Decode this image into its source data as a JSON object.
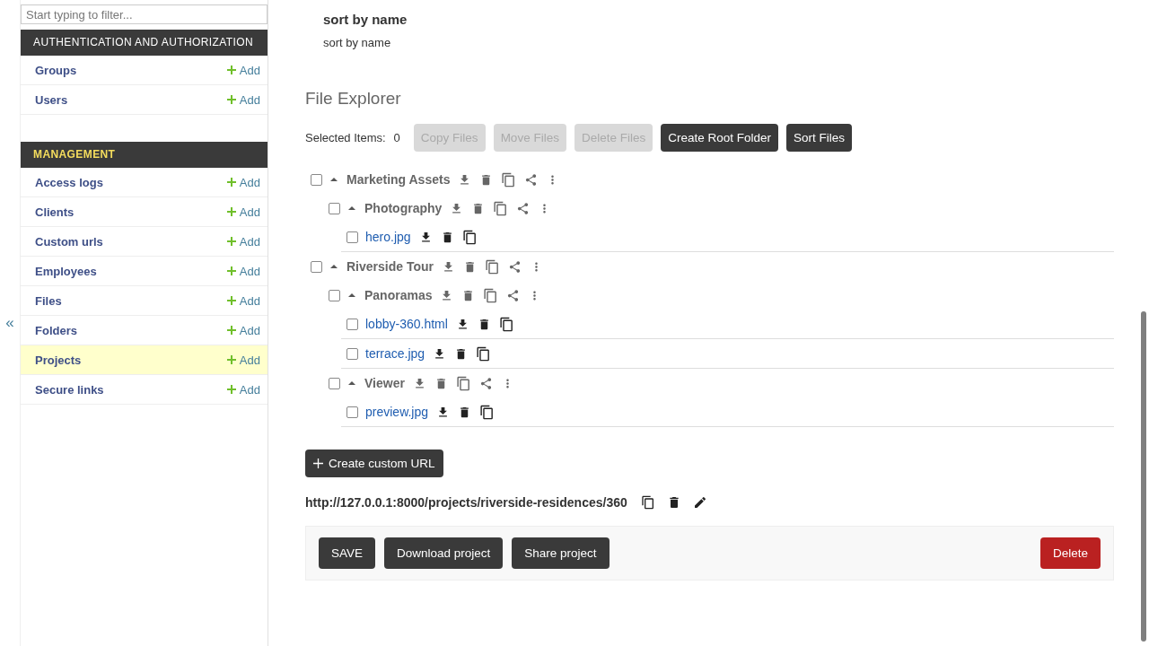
{
  "sidebar": {
    "filter": {
      "placeholder": "Start typing to filter..."
    },
    "collapse_toggle": "«",
    "sections": [
      {
        "title": "AUTHENTICATION AND AUTHORIZATION",
        "items": [
          {
            "label": "Groups",
            "add": "Add",
            "selected": false
          },
          {
            "label": "Users",
            "add": "Add",
            "selected": false
          }
        ]
      },
      {
        "title": "MANAGEMENT",
        "items": [
          {
            "label": "Access logs",
            "add": "Add",
            "selected": false
          },
          {
            "label": "Clients",
            "add": "Add",
            "selected": false
          },
          {
            "label": "Custom urls",
            "add": "Add",
            "selected": false
          },
          {
            "label": "Employees",
            "add": "Add",
            "selected": false
          },
          {
            "label": "Files",
            "add": "Add",
            "selected": false
          },
          {
            "label": "Folders",
            "add": "Add",
            "selected": false
          },
          {
            "label": "Projects",
            "add": "Add",
            "selected": true
          },
          {
            "label": "Secure links",
            "add": "Add",
            "selected": false
          }
        ]
      }
    ]
  },
  "sort": {
    "title": "sort by name",
    "text": "sort by name"
  },
  "file_explorer": {
    "title": "File Explorer",
    "selected_label": "Selected Items:",
    "selected_count": "0",
    "buttons": [
      {
        "label": "Copy Files",
        "disabled": true
      },
      {
        "label": "Move Files",
        "disabled": true
      },
      {
        "label": "Delete Files",
        "disabled": true
      },
      {
        "label": "Create Root Folder",
        "disabled": false
      },
      {
        "label": "Sort Files",
        "disabled": false
      }
    ],
    "tree": [
      {
        "kind": "folder",
        "name": "Marketing Assets",
        "checked": false,
        "expanded": true,
        "children": [
          {
            "kind": "folder",
            "name": "Photography",
            "checked": false,
            "expanded": true,
            "children": [
              {
                "kind": "file",
                "name": "hero.jpg",
                "checked": false
              }
            ]
          }
        ]
      },
      {
        "kind": "folder",
        "name": "Riverside Tour",
        "checked": false,
        "expanded": true,
        "children": [
          {
            "kind": "folder",
            "name": "Panoramas",
            "checked": false,
            "expanded": true,
            "children": [
              {
                "kind": "file",
                "name": "lobby-360.html",
                "checked": false
              },
              {
                "kind": "file",
                "name": "terrace.jpg",
                "checked": false
              }
            ]
          },
          {
            "kind": "folder",
            "name": "Viewer",
            "checked": false,
            "expanded": true,
            "children": [
              {
                "kind": "file",
                "name": "preview.jpg",
                "checked": false
              }
            ]
          }
        ]
      }
    ]
  },
  "custom_url": {
    "button": "Create custom URL",
    "url": "http://127.0.0.1:8000/projects/riverside-residences/360"
  },
  "actions": [
    {
      "label": "SAVE",
      "kind": "dark"
    },
    {
      "label": "Download project",
      "kind": "dark"
    },
    {
      "label": "Share project",
      "kind": "dark"
    },
    {
      "label": "Delete",
      "kind": "danger"
    }
  ]
}
